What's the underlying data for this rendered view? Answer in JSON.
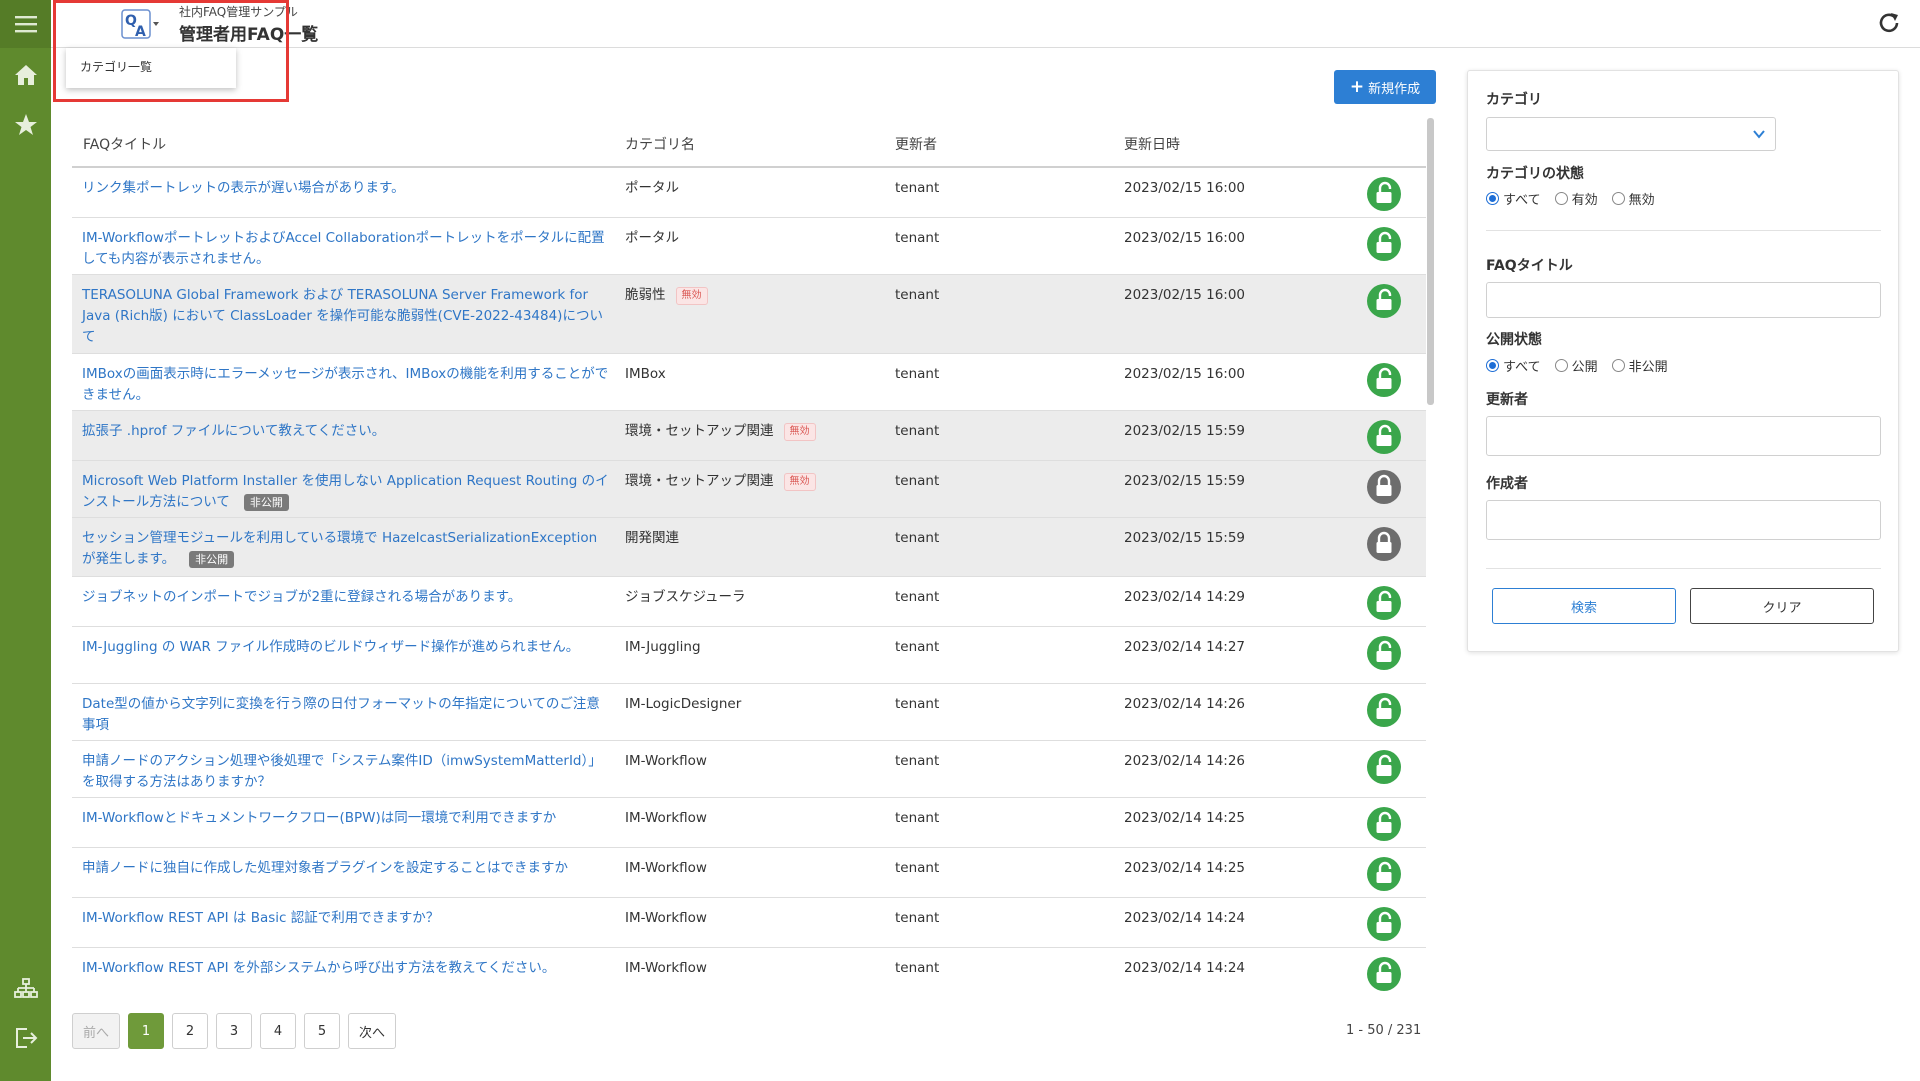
{
  "header": {
    "subtitle": "社内FAQ管理サンプル",
    "title": "管理者用FAQ一覧",
    "logo_text": "QA"
  },
  "menu": {
    "category_list": "カテゴリ一覧"
  },
  "toolbar": {
    "new_label": "新規作成"
  },
  "colors": {
    "sidebar": "#5f8a2d",
    "accent": "#2d7fd4",
    "public_lock": "#3aa64b",
    "private_lock": "#6d6d6d",
    "link": "#2f76c6"
  },
  "table": {
    "columns": [
      "FAQタイトル",
      "カテゴリ名",
      "更新者",
      "更新日時"
    ],
    "rows": [
      {
        "title": "リンク集ポートレットの表示が遅い場合があります。",
        "category": "ポータル",
        "category_status": "",
        "private": "",
        "user": "tenant",
        "date": "2023/02/15 16:00",
        "lock": "unlock-icon"
      },
      {
        "title": "IM-WorkflowポートレットおよびAccel Collaborationポートレットをポータルに配置しても内容が表示されません。",
        "category": "ポータル",
        "category_status": "",
        "private": "",
        "user": "tenant",
        "date": "2023/02/15 16:00",
        "lock": "unlock-icon"
      },
      {
        "title": "TERASOLUNA Global Framework および TERASOLUNA Server Framework for Java (Rich版) において ClassLoader を操作可能な脆弱性(CVE-2022-43484)について",
        "category": "脆弱性",
        "category_status": "無効",
        "private": "",
        "user": "tenant",
        "date": "2023/02/15 16:00",
        "lock": "unlock-icon"
      },
      {
        "title": "IMBoxの画面表示時にエラーメッセージが表示され、IMBoxの機能を利用することができません。",
        "category": "IMBox",
        "category_status": "",
        "private": "",
        "user": "tenant",
        "date": "2023/02/15 16:00",
        "lock": "unlock-icon"
      },
      {
        "title": "拡張子 .hprof ファイルについて教えてください。",
        "category": "環境・セットアップ関連",
        "category_status": "無効",
        "private": "",
        "user": "tenant",
        "date": "2023/02/15 15:59",
        "lock": "unlock-icon"
      },
      {
        "title": "Microsoft Web Platform Installer を使用しない Application Request Routing のインストール方法について",
        "category": "環境・セットアップ関連",
        "category_status": "無効",
        "private": "非公開",
        "user": "tenant",
        "date": "2023/02/15 15:59",
        "lock": "lock-icon"
      },
      {
        "title": "セッション管理モジュールを利用している環境で HazelcastSerializationException が発生します。",
        "category": "開発関連",
        "category_status": "",
        "private": "非公開",
        "user": "tenant",
        "date": "2023/02/15 15:59",
        "lock": "lock-icon"
      },
      {
        "title": "ジョブネットのインポートでジョブが2重に登録される場合があります。",
        "category": "ジョブスケジューラ",
        "category_status": "",
        "private": "",
        "user": "tenant",
        "date": "2023/02/14 14:29",
        "lock": "unlock-icon"
      },
      {
        "title": "IM-Juggling の WAR ファイル作成時のビルドウィザード操作が進められません。",
        "category": "IM-Juggling",
        "category_status": "",
        "private": "",
        "user": "tenant",
        "date": "2023/02/14 14:27",
        "lock": "unlock-icon"
      },
      {
        "title": "Date型の値から文字列に変換を行う際の日付フォーマットの年指定についてのご注意事項",
        "category": "IM-LogicDesigner",
        "category_status": "",
        "private": "",
        "user": "tenant",
        "date": "2023/02/14 14:26",
        "lock": "unlock-icon"
      },
      {
        "title": "申請ノードのアクション処理や後処理で「システム案件ID（imwSystemMatterId）」を取得する方法はありますか？",
        "category": "IM-Workflow",
        "category_status": "",
        "private": "",
        "user": "tenant",
        "date": "2023/02/14 14:26",
        "lock": "unlock-icon"
      },
      {
        "title": "IM-Workflowとドキュメントワークフロー(BPW)は同一環境で利用できますか",
        "category": "IM-Workflow",
        "category_status": "",
        "private": "",
        "user": "tenant",
        "date": "2023/02/14 14:25",
        "lock": "unlock-icon"
      },
      {
        "title": "申請ノードに独自に作成した処理対象者プラグインを設定することはできますか",
        "category": "IM-Workflow",
        "category_status": "",
        "private": "",
        "user": "tenant",
        "date": "2023/02/14 14:25",
        "lock": "unlock-icon"
      },
      {
        "title": "IM-Workflow REST API は Basic 認証で利用できますか？",
        "category": "IM-Workflow",
        "category_status": "",
        "private": "",
        "user": "tenant",
        "date": "2023/02/14 14:24",
        "lock": "unlock-icon"
      },
      {
        "title": "IM-Workflow REST API を外部システムから呼び出す方法を教えてください。",
        "category": "IM-Workflow",
        "category_status": "",
        "private": "",
        "user": "tenant",
        "date": "2023/02/14 14:24",
        "lock": "unlock-icon"
      }
    ]
  },
  "pager": {
    "prev": "前へ",
    "pages": [
      "1",
      "2",
      "3",
      "4",
      "5"
    ],
    "current": "1",
    "next": "次へ",
    "count": "1 -  50 / 231"
  },
  "search": {
    "category_label": "カテゴリ",
    "category_value": "",
    "category_status_label": "カテゴリの状態",
    "category_status_options": [
      "すべて",
      "有効",
      "無効"
    ],
    "category_status_selected": "すべて",
    "faq_title_label": "FAQタイトル",
    "publish_label": "公開状態",
    "publish_options": [
      "すべて",
      "公開",
      "非公開"
    ],
    "publish_selected": "すべて",
    "updater_label": "更新者",
    "creator_label": "作成者",
    "search_button": "検索",
    "clear_button": "クリア"
  }
}
